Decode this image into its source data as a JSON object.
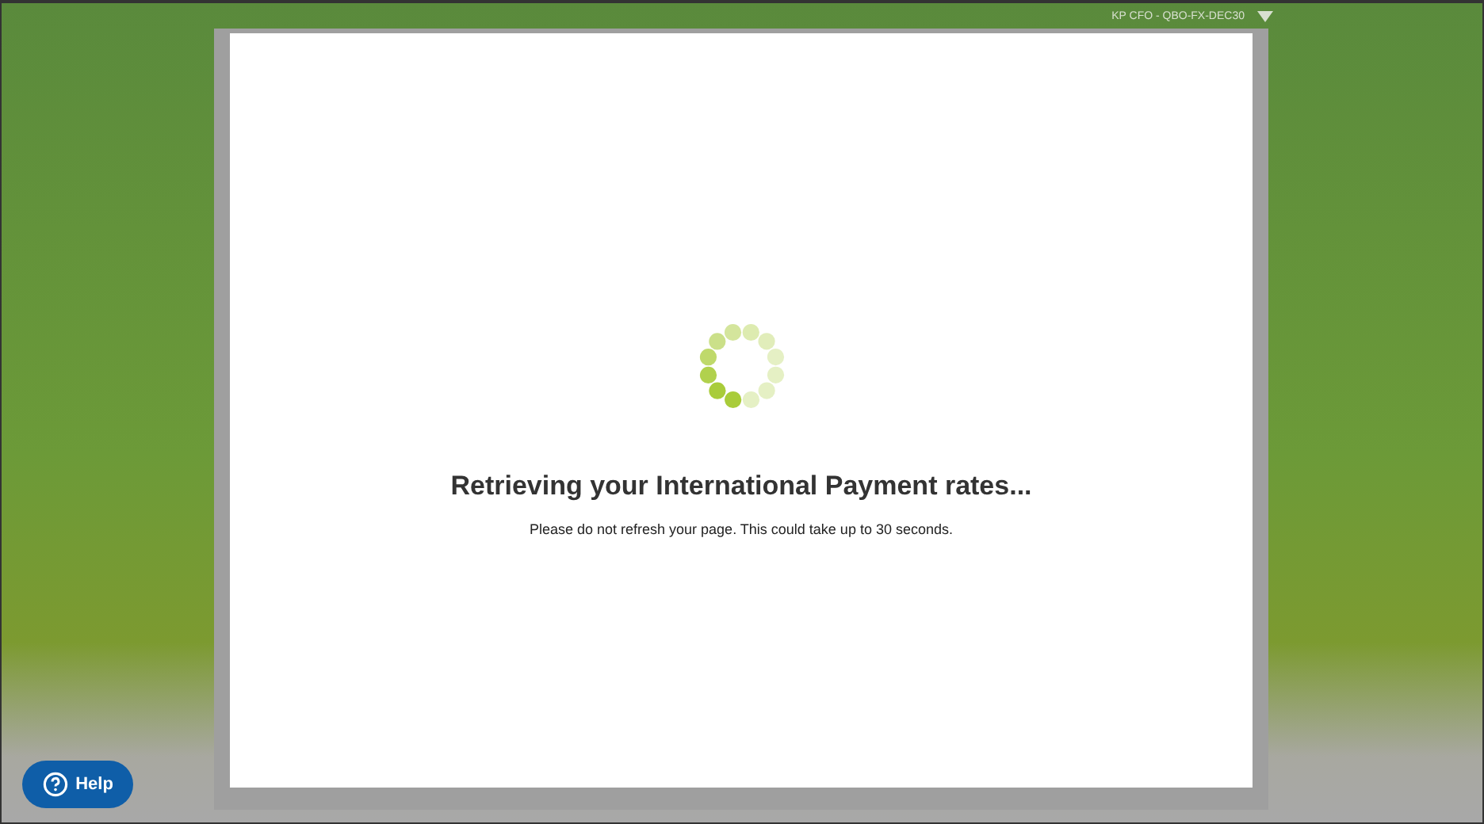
{
  "account_menu": {
    "label": "KP CFO - QBO-FX-DEC30"
  },
  "dialog": {
    "title": "Retrieving your International Payment rates...",
    "message": "Please do not refresh your page. This could take up to 30 seconds."
  },
  "help_button": {
    "label": "Help"
  }
}
